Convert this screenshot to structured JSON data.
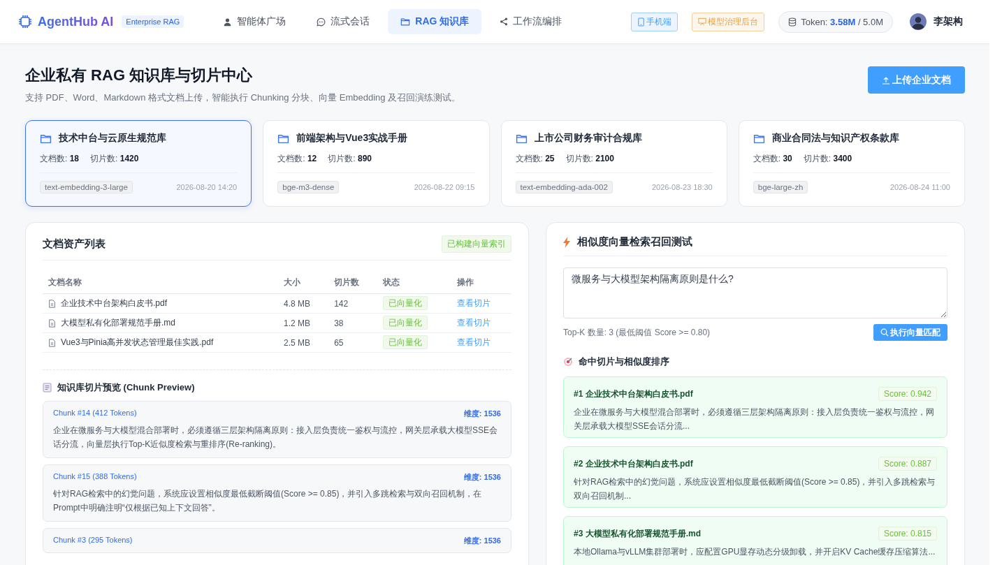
{
  "brand": {
    "name": "AgentHub AI",
    "badge": "Enterprise RAG"
  },
  "nav": [
    {
      "label": "智能体广场",
      "selected": false
    },
    {
      "label": "流式会话",
      "selected": false
    },
    {
      "label": "RAG 知识库",
      "selected": true
    },
    {
      "label": "工作流编排",
      "selected": false
    }
  ],
  "header_actions": [
    {
      "label": "手机端",
      "kind": "mobile"
    },
    {
      "label": "模型治理后台",
      "kind": "admin"
    }
  ],
  "token": {
    "label": "Token:",
    "used": "3.58M",
    "total": "/ 5.0M"
  },
  "user": {
    "name": "李架构"
  },
  "page": {
    "title": "企业私有 RAG 知识库与切片中心",
    "subtitle": "支持 PDF、Word、Markdown 格式文档上传，智能执行 Chunking 分块、向量 Embedding 及召回演练测试。",
    "upload_button": "上传企业文档"
  },
  "knowledge_bases": [
    {
      "name": "技术中台与云原生规范库",
      "docs_label": "文档数:",
      "docs": "18",
      "chunks_label": "切片数:",
      "chunks": "1420",
      "model": "text-embedding-3-large",
      "date": "2026-08-20 14:20",
      "selected": true
    },
    {
      "name": "前端架构与Vue3实战手册",
      "docs_label": "文档数:",
      "docs": "12",
      "chunks_label": "切片数:",
      "chunks": "890",
      "model": "bge-m3-dense",
      "date": "2026-08-22 09:15",
      "selected": false
    },
    {
      "name": "上市公司财务审计合规库",
      "docs_label": "文档数:",
      "docs": "25",
      "chunks_label": "切片数:",
      "chunks": "2100",
      "model": "text-embedding-ada-002",
      "date": "2026-08-23 18:30",
      "selected": false
    },
    {
      "name": "商业合同法与知识产权条款库",
      "docs_label": "文档数:",
      "docs": "30",
      "chunks_label": "切片数:",
      "chunks": "3400",
      "model": "bge-large-zh",
      "date": "2026-08-24 11:00",
      "selected": false
    }
  ],
  "documents": {
    "title": "文档资产列表",
    "badge": "已构建向量索引",
    "columns": [
      "文档名称",
      "大小",
      "切片数",
      "状态",
      "操作"
    ],
    "rows": [
      {
        "name": "企业技术中台架构白皮书.pdf",
        "size": "4.8 MB",
        "chunks": "142",
        "status": "已向量化",
        "action": "查看切片"
      },
      {
        "name": "大模型私有化部署规范手册.md",
        "size": "1.2 MB",
        "chunks": "38",
        "status": "已向量化",
        "action": "查看切片"
      },
      {
        "name": "Vue3与Pinia高并发状态管理最佳实践.pdf",
        "size": "2.5 MB",
        "chunks": "65",
        "status": "已向量化",
        "action": "查看切片"
      }
    ]
  },
  "chunk_preview": {
    "title": "知识库切片预览 (Chunk Preview)",
    "chunks": [
      {
        "label": "Chunk #14 (412 Tokens)",
        "dimension": "维度: 1536",
        "text": "企业在微服务与大模型混合部署时，必须遵循三层架构隔离原则：接入层负责统一鉴权与流控，网关层承载大模型SSE会话分流，向量层执行Top-K近似度检索与重排序(Re-ranking)。"
      },
      {
        "label": "Chunk #15 (388 Tokens)",
        "dimension": "维度: 1536",
        "text": "针对RAG检索中的幻觉问题，系统应设置相似度最低截断阈值(Score >= 0.85)，并引入多跳检索与双向召回机制，在Prompt中明确注明“仅根据已知上下文回答”。"
      },
      {
        "label": "Chunk #3 (295 Tokens)",
        "dimension": "维度: 1536"
      }
    ]
  },
  "retrieval": {
    "title": "相似度向量检索召回测试",
    "query": "微服务与大模型架构隔离原则是什么?",
    "topk": "Top-K 数量: 3 (最低阈值 Score >= 0.80)",
    "button": "执行向量匹配",
    "results_title": "命中切片与相似度排序",
    "results": [
      {
        "title": "#1 企业技术中台架构白皮书.pdf",
        "score": "Score: 0.942",
        "text": "企业在微服务与大模型混合部署时，必须遵循三层架构隔离原则：接入层负责统一鉴权与流控，网关层承载大模型SSE会话分流..."
      },
      {
        "title": "#2 企业技术中台架构白皮书.pdf",
        "score": "Score: 0.887",
        "text": "针对RAG检索中的幻觉问题，系统应设置相似度最低截断阈值(Score >= 0.85)，并引入多跳检索与双向召回机制..."
      },
      {
        "title": "#3 大模型私有化部署规范手册.md",
        "score": "Score: 0.815",
        "text": "本地Ollama与vLLM集群部署时，应配置GPU显存动态分级卸载，并开启KV Cache缓存压缩算法..."
      }
    ]
  }
}
